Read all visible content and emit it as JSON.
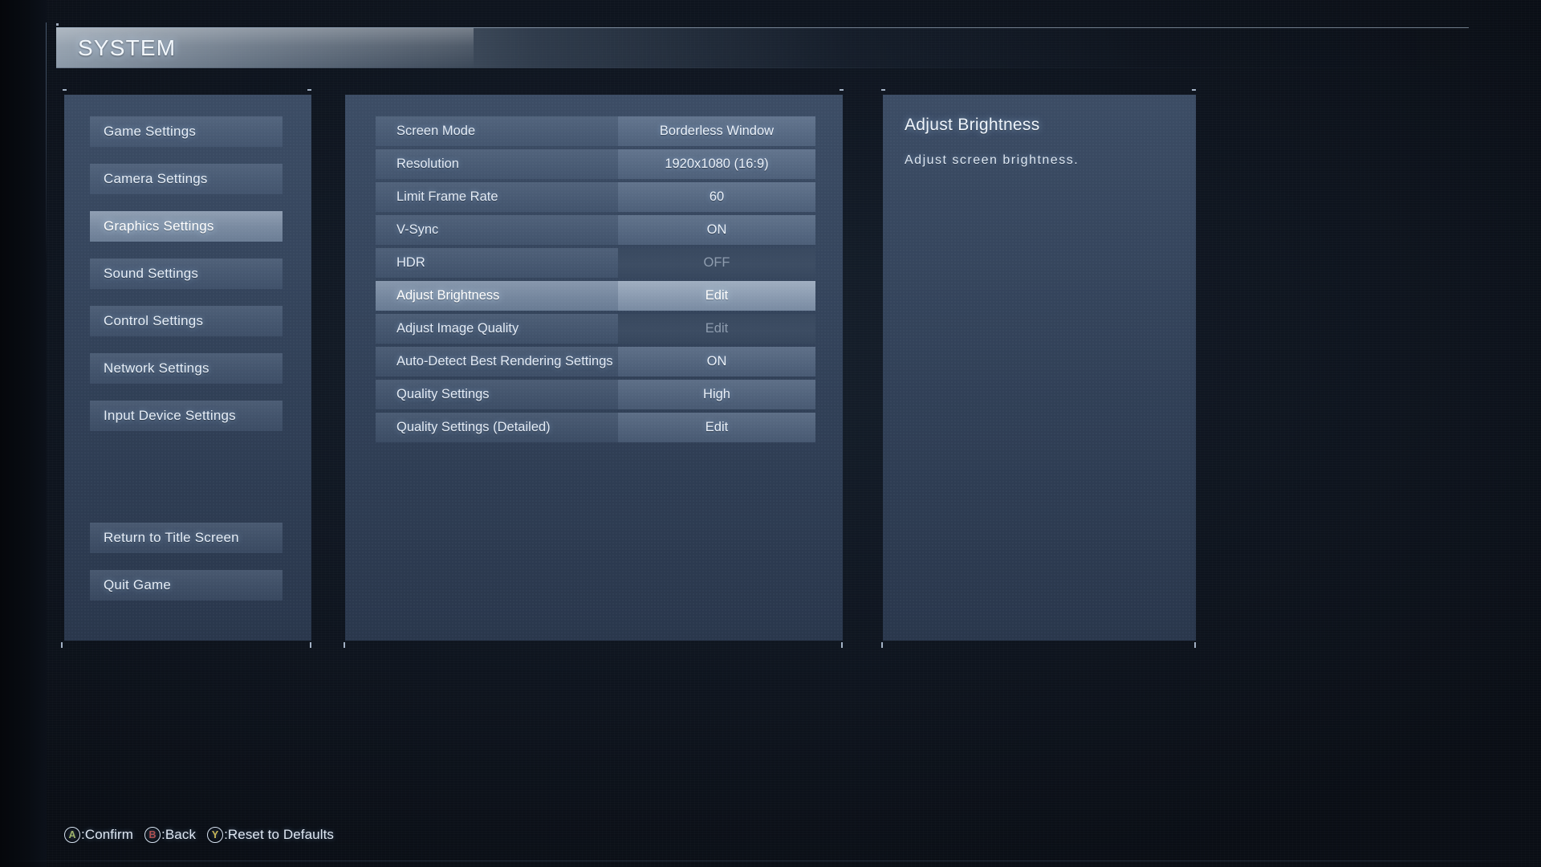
{
  "header": {
    "title": "SYSTEM"
  },
  "sidebar": {
    "items": [
      {
        "label": "Game Settings",
        "selected": false
      },
      {
        "label": "Camera Settings",
        "selected": false
      },
      {
        "label": "Graphics Settings",
        "selected": true
      },
      {
        "label": "Sound Settings",
        "selected": false
      },
      {
        "label": "Control Settings",
        "selected": false
      },
      {
        "label": "Network Settings",
        "selected": false
      },
      {
        "label": "Input Device Settings",
        "selected": false
      }
    ],
    "footer_items": [
      {
        "label": "Return to Title Screen"
      },
      {
        "label": "Quit Game"
      }
    ]
  },
  "settings": {
    "rows": [
      {
        "label": "Screen Mode",
        "value": "Borderless Window",
        "state": "normal"
      },
      {
        "label": "Resolution",
        "value": "1920x1080 (16:9)",
        "state": "normal"
      },
      {
        "label": "Limit Frame Rate",
        "value": "60",
        "state": "normal"
      },
      {
        "label": "V-Sync",
        "value": "ON",
        "state": "normal"
      },
      {
        "label": "HDR",
        "value": "OFF",
        "state": "disabled"
      },
      {
        "label": "Adjust Brightness",
        "value": "Edit",
        "state": "selected"
      },
      {
        "label": "Adjust Image Quality",
        "value": "Edit",
        "state": "disabled"
      },
      {
        "label": "Auto-Detect Best Rendering Settings",
        "value": "ON",
        "state": "normal"
      },
      {
        "label": "Quality Settings",
        "value": "High",
        "state": "normal"
      },
      {
        "label": "Quality Settings (Detailed)",
        "value": "Edit",
        "state": "normal"
      }
    ]
  },
  "description": {
    "title": "Adjust Brightness",
    "body": "Adjust screen brightness."
  },
  "prompts": [
    {
      "button": "A",
      "label": ":Confirm",
      "color": "#9fb36a"
    },
    {
      "button": "B",
      "label": ":Back",
      "color": "#b05050"
    },
    {
      "button": "Y",
      "label": ":Reset to Defaults",
      "color": "#c9b857"
    }
  ]
}
